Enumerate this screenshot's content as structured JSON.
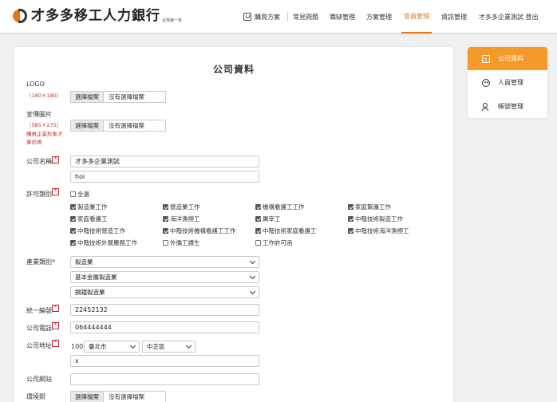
{
  "brand": {
    "name": "才多多移工人力銀行",
    "tagline": "台灣第一家"
  },
  "nav": {
    "items": [
      {
        "label": "購買方案"
      },
      {
        "label": "常見問題"
      },
      {
        "label": "職缺管理"
      },
      {
        "label": "方案管理"
      },
      {
        "label": "會員管理"
      },
      {
        "label": "資訊管理"
      },
      {
        "label": "才多多企業測試 登出"
      }
    ],
    "active": "會員管理",
    "accent_color": "#e8731a"
  },
  "form": {
    "title": "公司資料",
    "logo": {
      "label": "LOGO",
      "note": "（180＊180）",
      "file_button": "選擇檔案",
      "file_status": "沒有選擇檔案"
    },
    "banner": {
      "label": "宣傳圖片",
      "note1": "（585＊275）",
      "note2": "購買企業形象才",
      "note3": "會出現",
      "file_button": "選擇檔案",
      "file_status": "沒有選擇檔案"
    },
    "company_name": {
      "label": "公司名稱",
      "value_zh": "才多多企業測試",
      "value_en": "hoi"
    },
    "license": {
      "label": "許可類別",
      "select_all": "全選",
      "options": [
        {
          "label": "製造業工作",
          "checked": true
        },
        {
          "label": "營造業工作",
          "checked": true
        },
        {
          "label": "機構看護工工作",
          "checked": true
        },
        {
          "label": "家庭幫傭工作",
          "checked": true
        },
        {
          "label": "家庭看護工",
          "checked": true
        },
        {
          "label": "海洋漁撈工",
          "checked": true
        },
        {
          "label": "屠宰工",
          "checked": true
        },
        {
          "label": "中階技術製造工作",
          "checked": true
        },
        {
          "label": "中階技術營造工作",
          "checked": true
        },
        {
          "label": "中階技術機構看護工工作",
          "checked": true
        },
        {
          "label": "中階技術家庭看護工",
          "checked": true
        },
        {
          "label": "中階技術海洋漁撈工",
          "checked": true
        },
        {
          "label": "中階技術外展農務工作",
          "checked": true
        },
        {
          "label": "外僑工讀生",
          "checked": false
        },
        {
          "label": "工作許可函",
          "checked": false
        }
      ]
    },
    "industry": {
      "label": "產業類別*",
      "level1": "製造業",
      "level2": "基本金屬製造業",
      "level3": "鋼鐵製造業"
    },
    "tax_id": {
      "label": "統一編號",
      "value": "22452132"
    },
    "phone": {
      "label": "公司電話",
      "value": "064444444"
    },
    "address": {
      "label": "公司地址",
      "zip": "100",
      "city": "臺北市",
      "district": "中正區",
      "street": "x"
    },
    "website": {
      "label": "公司網站",
      "value": ""
    },
    "environment": {
      "label": "環境照",
      "file_button": "選擇檔案",
      "file_status": "沒有選擇檔案"
    },
    "required_mark": "*"
  },
  "side_menu": {
    "items": [
      {
        "label": "公司資料",
        "icon": "document-icon"
      },
      {
        "label": "人員管理",
        "icon": "people-icon"
      },
      {
        "label": "帳號管理",
        "icon": "user-icon"
      }
    ],
    "active_color": "#f39a2a"
  }
}
